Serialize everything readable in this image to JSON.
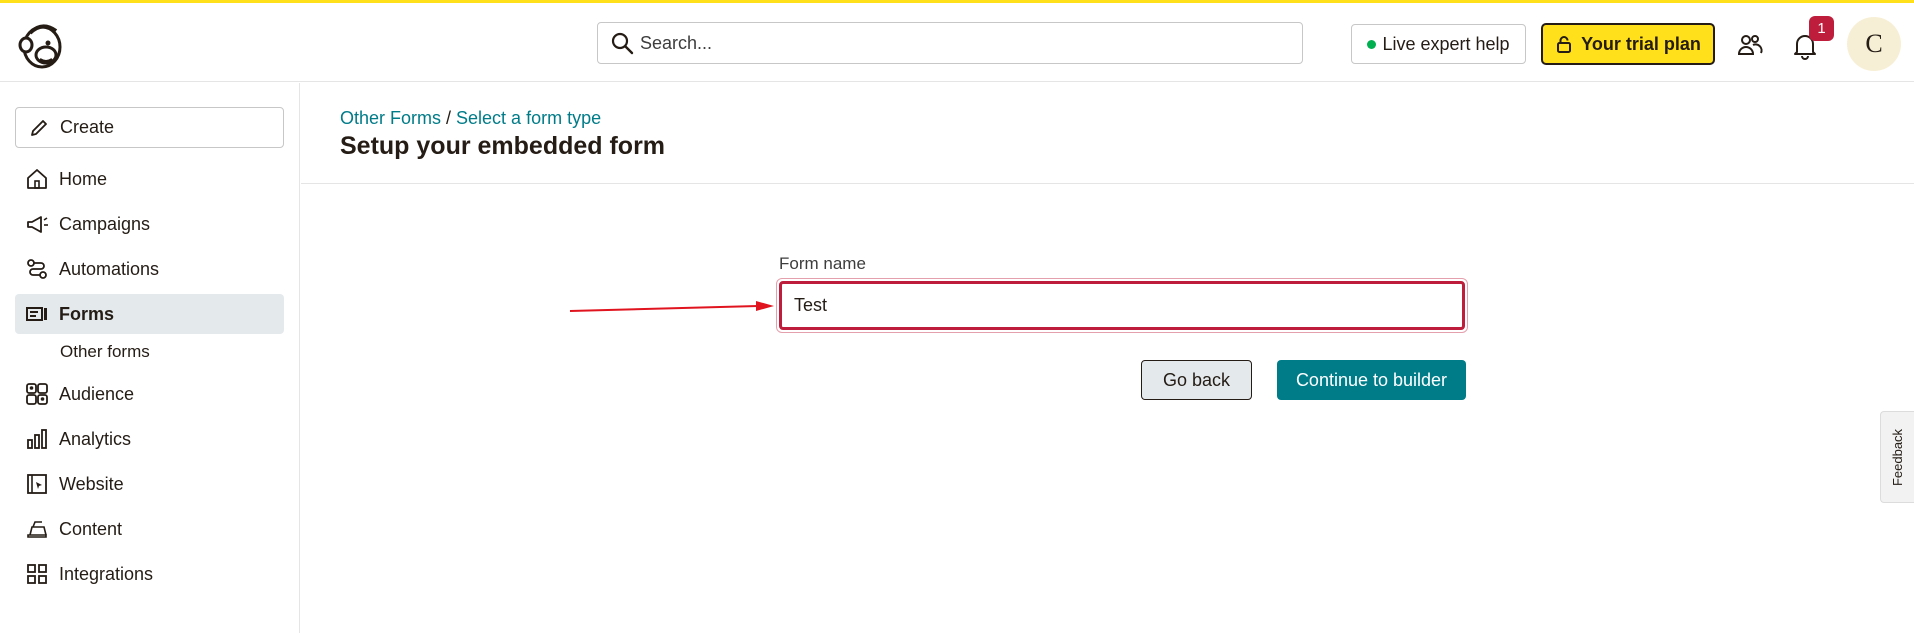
{
  "header": {
    "search_placeholder": "Search...",
    "live_help": "Live expert help",
    "trial": "Your trial plan",
    "notifications_count": "1",
    "avatar_initial": "C"
  },
  "sidebar": {
    "create": "Create",
    "items": [
      {
        "label": "Home",
        "icon": "home-icon"
      },
      {
        "label": "Campaigns",
        "icon": "megaphone-icon"
      },
      {
        "label": "Automations",
        "icon": "automation-icon"
      },
      {
        "label": "Forms",
        "icon": "forms-icon"
      },
      {
        "label": "Audience",
        "icon": "audience-icon"
      },
      {
        "label": "Analytics",
        "icon": "bar-chart-icon"
      },
      {
        "label": "Website",
        "icon": "website-icon"
      },
      {
        "label": "Content",
        "icon": "content-icon"
      },
      {
        "label": "Integrations",
        "icon": "grid-icon"
      }
    ],
    "sub_item": "Other forms"
  },
  "main": {
    "breadcrumb": {
      "part1": "Other Forms",
      "separator": " / ",
      "part2": "Select a form type"
    },
    "title": "Setup your embedded form",
    "form_label": "Form name",
    "form_value": "Test",
    "go_back": "Go back",
    "continue": "Continue to builder"
  },
  "feedback": "Feedback",
  "colors": {
    "accent": "#007c89",
    "brand_yellow": "#ffe01b",
    "error": "#be1e3c"
  }
}
